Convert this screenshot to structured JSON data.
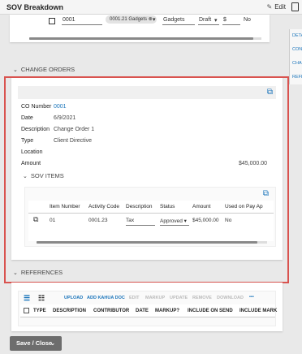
{
  "window": {
    "title": "SOV Breakdown",
    "edit_label": "Edit"
  },
  "right_panel": {
    "items": [
      "DETA",
      "CON",
      "CHA",
      "REFE"
    ]
  },
  "top_row": {
    "number": "0001",
    "chip": "0001.21 Gadgets",
    "name": "Gadgets",
    "status": "Draft",
    "currency": "$",
    "used": "No"
  },
  "change_orders": {
    "header": "CHANGE ORDERS",
    "fields": [
      {
        "label": "CO Number",
        "value": "0001"
      },
      {
        "label": "Date",
        "value": "6/9/2021"
      },
      {
        "label": "Description",
        "value": "Change Order 1"
      },
      {
        "label": "Type",
        "value": "Client Directive"
      },
      {
        "label": "Location",
        "value": ""
      },
      {
        "label": "Amount",
        "value": "$45,000.00"
      }
    ],
    "sov_items": {
      "header": "SOV ITEMS",
      "columns": [
        "Item Number",
        "Activity Code",
        "Description",
        "Status",
        "Amount",
        "Used on Pay Ap"
      ],
      "rows": [
        {
          "item_number": "01",
          "activity_code": "0001.23",
          "description": "Tax",
          "status": "Approved",
          "amount": "$45,000.00",
          "used": "No"
        }
      ]
    }
  },
  "references": {
    "header": "REFERENCES",
    "toolbar": [
      "UPLOAD",
      "ADD KAHUA DOC",
      "EDIT",
      "MARKUP",
      "UPDATE",
      "REMOVE",
      "DOWNLOAD"
    ],
    "more": "•••",
    "columns": [
      "TYPE",
      "DESCRIPTION",
      "CONTRIBUTOR",
      "DATE",
      "MARKUP?",
      "INCLUDE ON SEND",
      "INCLUDE MARK"
    ]
  },
  "footer": {
    "save_label": "Save / Close"
  },
  "colors": {
    "accent": "#1b75bb",
    "highlight": "#d9534f"
  }
}
